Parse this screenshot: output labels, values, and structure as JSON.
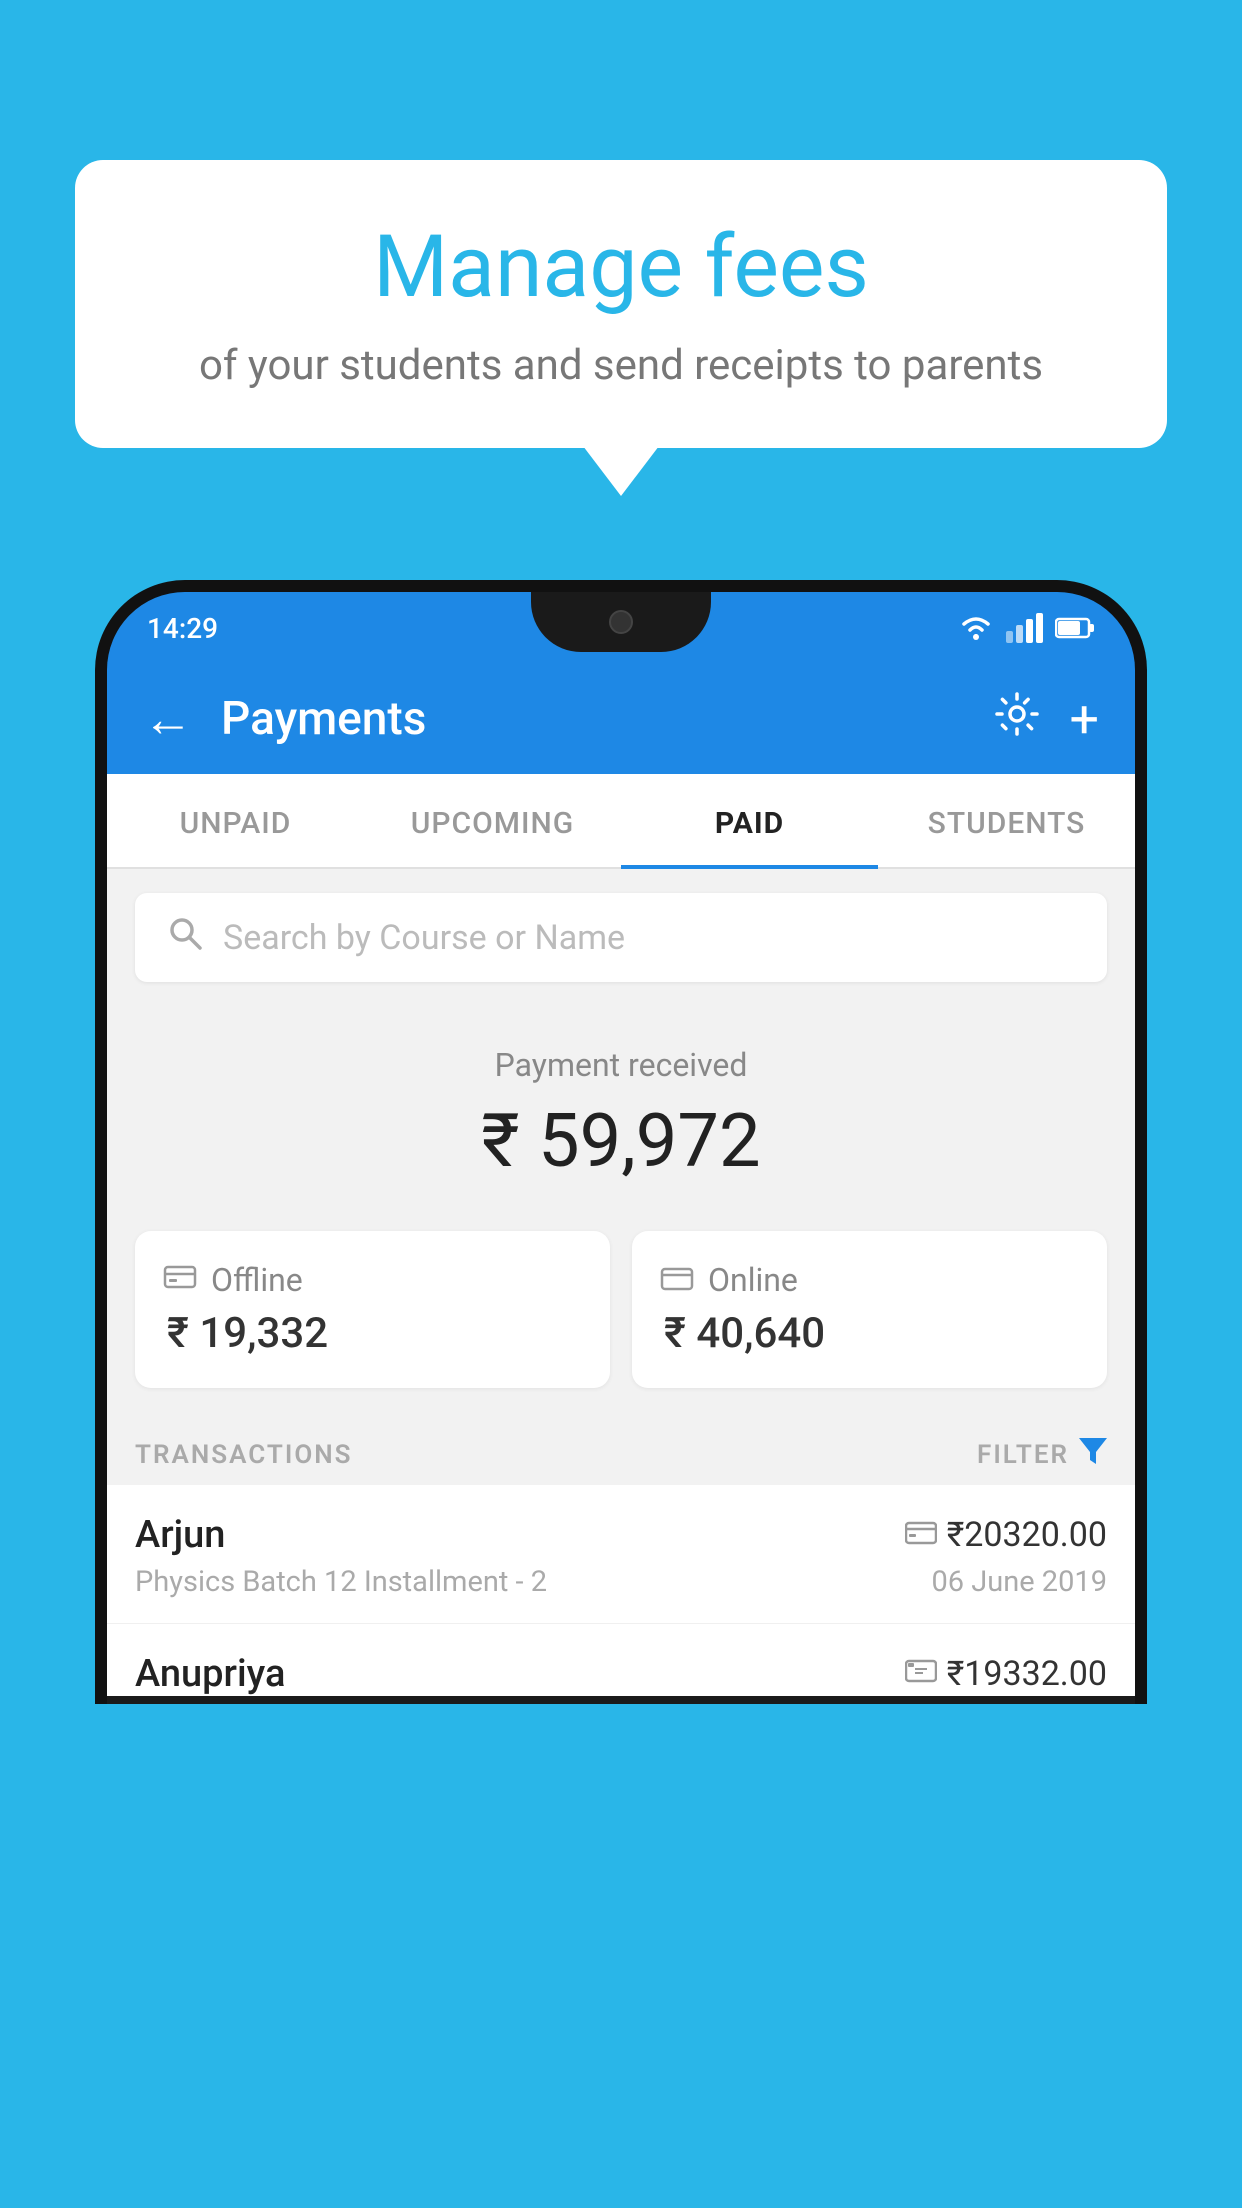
{
  "background_color": "#29b6e8",
  "speech_bubble": {
    "title": "Manage fees",
    "subtitle": "of your students and send receipts to parents"
  },
  "status_bar": {
    "time": "14:29"
  },
  "toolbar": {
    "title": "Payments",
    "back_label": "←",
    "settings_label": "⚙",
    "add_label": "+"
  },
  "tabs": [
    {
      "id": "unpaid",
      "label": "UNPAID",
      "active": false
    },
    {
      "id": "upcoming",
      "label": "UPCOMING",
      "active": false
    },
    {
      "id": "paid",
      "label": "PAID",
      "active": true
    },
    {
      "id": "students",
      "label": "STUDENTS",
      "active": false
    }
  ],
  "search": {
    "placeholder": "Search by Course or Name"
  },
  "payment_summary": {
    "received_label": "Payment received",
    "amount": "₹ 59,972",
    "offline": {
      "label": "Offline",
      "amount": "₹ 19,332"
    },
    "online": {
      "label": "Online",
      "amount": "₹ 40,640"
    }
  },
  "transactions": {
    "header_label": "TRANSACTIONS",
    "filter_label": "FILTER",
    "items": [
      {
        "name": "Arjun",
        "mode_icon": "card",
        "amount": "₹20320.00",
        "detail": "Physics Batch 12 Installment - 2",
        "date": "06 June 2019"
      },
      {
        "name": "Anupriya",
        "mode_icon": "cash",
        "amount": "₹19332.00",
        "detail": "",
        "date": ""
      }
    ]
  }
}
